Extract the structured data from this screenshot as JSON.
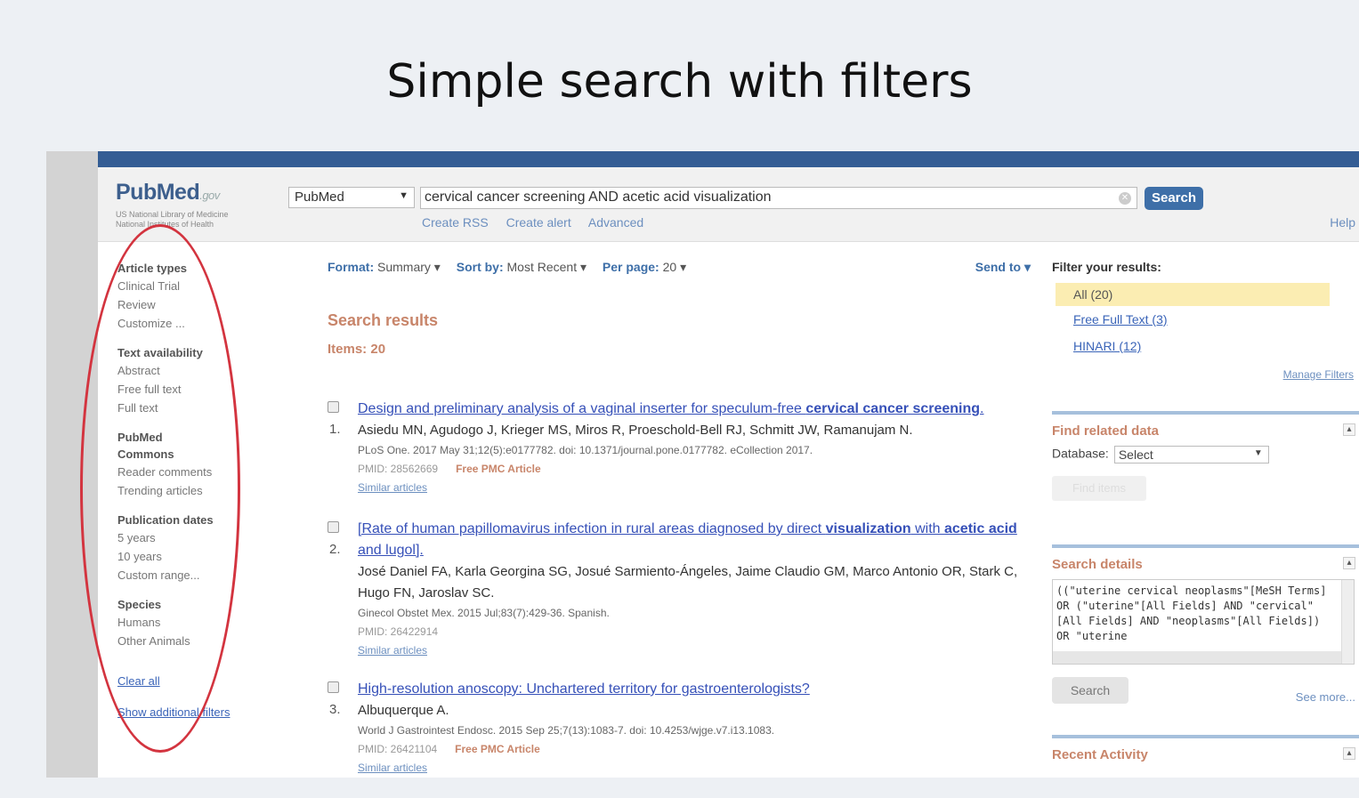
{
  "slide_title": "Simple search with filters",
  "header": {
    "logo_main": "PubMed",
    "logo_gov": ".gov",
    "logo_sub": "US National Library of Medicine National Institutes of Health",
    "db_value": "PubMed",
    "query": "cervical cancer screening AND acetic acid visualization",
    "search_label": "Search",
    "links": [
      "Create RSS",
      "Create alert",
      "Advanced"
    ],
    "help": "Help"
  },
  "sidebar": {
    "groups": [
      {
        "title": "Article types",
        "items": [
          "Clinical Trial",
          "Review",
          "Customize ..."
        ]
      },
      {
        "title": "Text availability",
        "items": [
          "Abstract",
          "Free full text",
          "Full text"
        ]
      },
      {
        "title": "PubMed Commons",
        "items": [
          "Reader comments",
          "Trending articles"
        ]
      },
      {
        "title": "Publication dates",
        "items": [
          "5 years",
          "10 years",
          "Custom range..."
        ]
      },
      {
        "title": "Species",
        "items": [
          "Humans",
          "Other Animals"
        ]
      }
    ],
    "clear_all": "Clear all",
    "show_additional": "Show additional filters"
  },
  "toolbar": {
    "format_label": "Format:",
    "format_value": "Summary",
    "sort_label": "Sort by:",
    "sort_value": "Most Recent",
    "perpage_label": "Per page:",
    "perpage_value": "20",
    "send_to": "Send to"
  },
  "results_heading": "Search results",
  "items_count": "Items: 20",
  "results": [
    {
      "num": "1.",
      "title_pre": "Design and preliminary analysis of a vaginal inserter for speculum-free ",
      "title_bold": "cervical cancer screening",
      "title_post": ".",
      "authors": "Asiedu MN, Agudogo J, Krieger MS, Miros R, Proeschold-Bell RJ, Schmitt JW, Ramanujam N.",
      "journal": "PLoS One. 2017 May 31;12(5):e0177782. doi: 10.1371/journal.pone.0177782. eCollection 2017.",
      "pmid": "PMID: 28562669",
      "pmc": "Free PMC Article",
      "similar": "Similar articles"
    },
    {
      "num": "2.",
      "title_pre": "[Rate of human papillomavirus infection in rural areas diagnosed by direct ",
      "title_bold": "visualization",
      "title_mid": " with ",
      "title_bold2": "acetic acid",
      "title_post": " and lugol].",
      "authors": "José Daniel FA, Karla Georgina SG, Josué Sarmiento-Ángeles, Jaime Claudio GM, Marco Antonio OR, Stark C, Hugo FN, Jaroslav SC.",
      "journal": "Ginecol Obstet Mex. 2015 Jul;83(7):429-36. Spanish.",
      "pmid": "PMID: 26422914",
      "pmc": "",
      "similar": "Similar articles"
    },
    {
      "num": "3.",
      "title_pre": "High-resolution anoscopy: Unchartered territory for gastroenterologists?",
      "authors": "Albuquerque A.",
      "journal": "World J Gastrointest Endosc. 2015 Sep 25;7(13):1083-7. doi: 10.4253/wjge.v7.i13.1083.",
      "pmid": "PMID: 26421104",
      "pmc": "Free PMC Article",
      "similar": "Similar articles"
    }
  ],
  "right_panel": {
    "filter_title": "Filter your results:",
    "filter_all": "All (20)",
    "filter_links": [
      "Free Full Text (3)",
      "HINARI (12)"
    ],
    "manage_filters": "Manage Filters",
    "related_title": "Find related data",
    "database_label": "Database:",
    "database_value": "Select",
    "find_items": "Find items",
    "details_title": "Search details",
    "details_text": "((\"uterine cervical neoplasms\"[MeSH Terms] OR (\"uterine\"[All Fields] AND \"cervical\"[All Fields] AND \"neoplasms\"[All Fields]) OR \"uterine",
    "details_search": "Search",
    "see_more": "See more...",
    "recent_title": "Recent Activity"
  }
}
